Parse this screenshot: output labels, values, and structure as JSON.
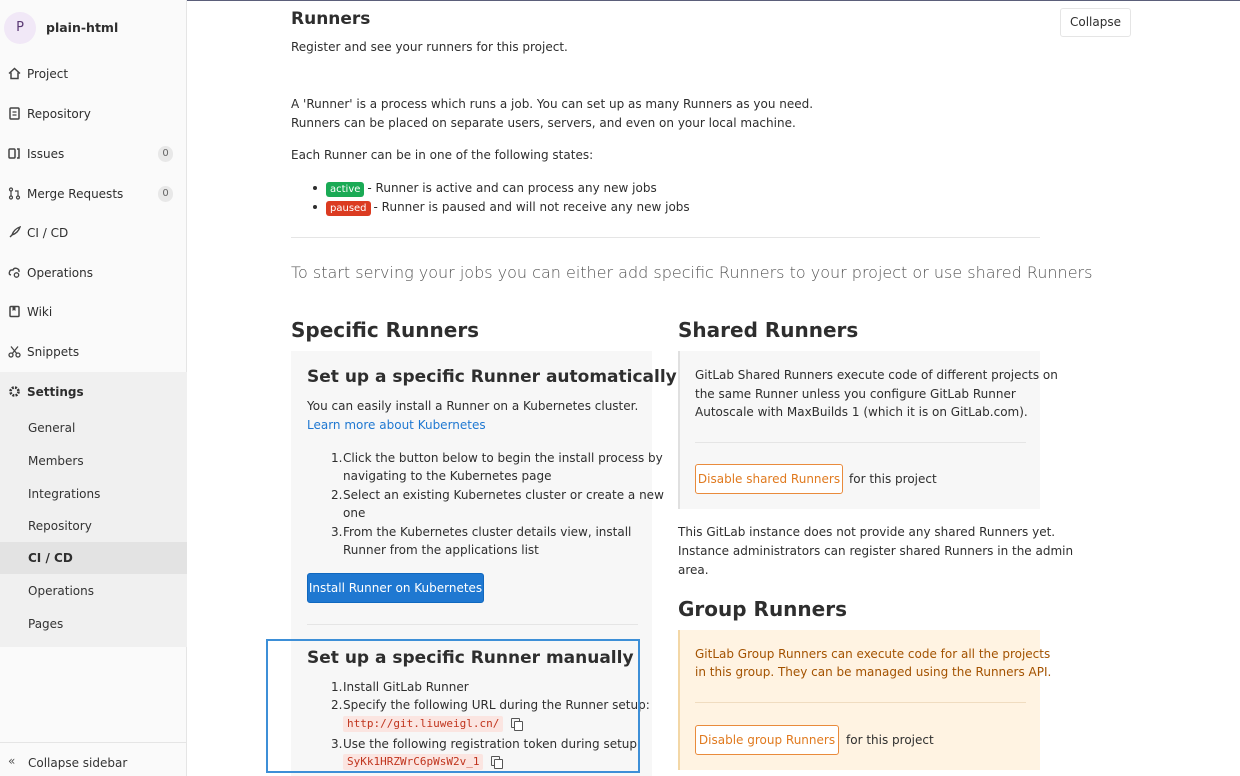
{
  "sidebar": {
    "project_initial": "P",
    "project_name": "plain-html",
    "items": [
      {
        "label": "Project",
        "icon": "home-icon"
      },
      {
        "label": "Repository",
        "icon": "doc-icon"
      },
      {
        "label": "Issues",
        "icon": "issues-icon",
        "count": "0"
      },
      {
        "label": "Merge Requests",
        "icon": "merge-request-icon",
        "count": "0"
      },
      {
        "label": "CI / CD",
        "icon": "rocket-icon"
      },
      {
        "label": "Operations",
        "icon": "cloud-gear-icon"
      },
      {
        "label": "Wiki",
        "icon": "book-icon"
      },
      {
        "label": "Snippets",
        "icon": "scissors-icon"
      }
    ],
    "settings_label": "Settings",
    "settings_sub": [
      "General",
      "Members",
      "Integrations",
      "Repository",
      "CI / CD",
      "Operations",
      "Pages"
    ],
    "active_sub": "CI / CD",
    "collapse_label": "Collapse sidebar"
  },
  "main": {
    "title": "Runners",
    "subtitle": "Register and see your runners for this project.",
    "collapse_button": "Collapse",
    "intro_line1": "A 'Runner' is a process which runs a job. You can set up as many Runners as you need.",
    "intro_line2": "Runners can be placed on separate users, servers, and even on your local machine.",
    "states_intro": "Each Runner can be in one of the following states:",
    "states": [
      {
        "badge": "active",
        "desc": "- Runner is active and can process any new jobs",
        "color": "#1aaa55"
      },
      {
        "badge": "paused",
        "desc": "- Runner is paused and will not receive any new jobs",
        "color": "#db3b21"
      }
    ],
    "lead": "To start serving your jobs you can either add specific Runners to your project or use shared Runners"
  },
  "specific": {
    "heading": "Specific Runners",
    "auto_heading": "Set up a specific Runner automatically",
    "auto_desc": "You can easily install a Runner on a Kubernetes cluster.",
    "auto_link": "Learn more about Kubernetes",
    "steps": [
      "Click the button below to begin the install process by",
      "navigating to the Kubernetes page",
      "Select an existing Kubernetes cluster or create a new",
      "one",
      "From the Kubernetes cluster details view, install",
      "Runner from the applications list"
    ],
    "step_numbers": [
      "1.",
      "2.",
      "3."
    ],
    "install_button": "Install Runner on Kubernetes",
    "manual_heading": "Set up a specific Runner manually",
    "manual_step1_link": "Install GitLab Runner",
    "manual_step2": "Specify the following URL during the Runner setup:",
    "url": "http://git.liuweigl.cn/",
    "manual_step3": "Use the following registration token during setup:",
    "token": "SyKk1HRZWrC6pWsW2v_1"
  },
  "shared": {
    "heading": "Shared Runners",
    "desc_lines": [
      "GitLab Shared Runners execute code of different projects on",
      "the same Runner unless you configure GitLab Runner",
      "Autoscale with MaxBuilds 1 (which it is on GitLab.com)."
    ],
    "disable_button": "Disable shared Runners",
    "for_project": "for this project",
    "none_lines": [
      "This GitLab instance does not provide any shared Runners yet.",
      "Instance administrators can register shared Runners in the admin",
      "area."
    ]
  },
  "group": {
    "heading": "Group Runners",
    "desc_lines": [
      "GitLab Group Runners can execute code for all the projects",
      "in this group. They can be managed using the Runners API."
    ],
    "disable_button": "Disable group Runners",
    "for_project": "for this project"
  },
  "colors": {
    "accent": "#1f78d1",
    "success": "#1aaa55",
    "danger": "#db3b21",
    "warning": "#e07a1f",
    "highlight": "#3d8fd7"
  }
}
